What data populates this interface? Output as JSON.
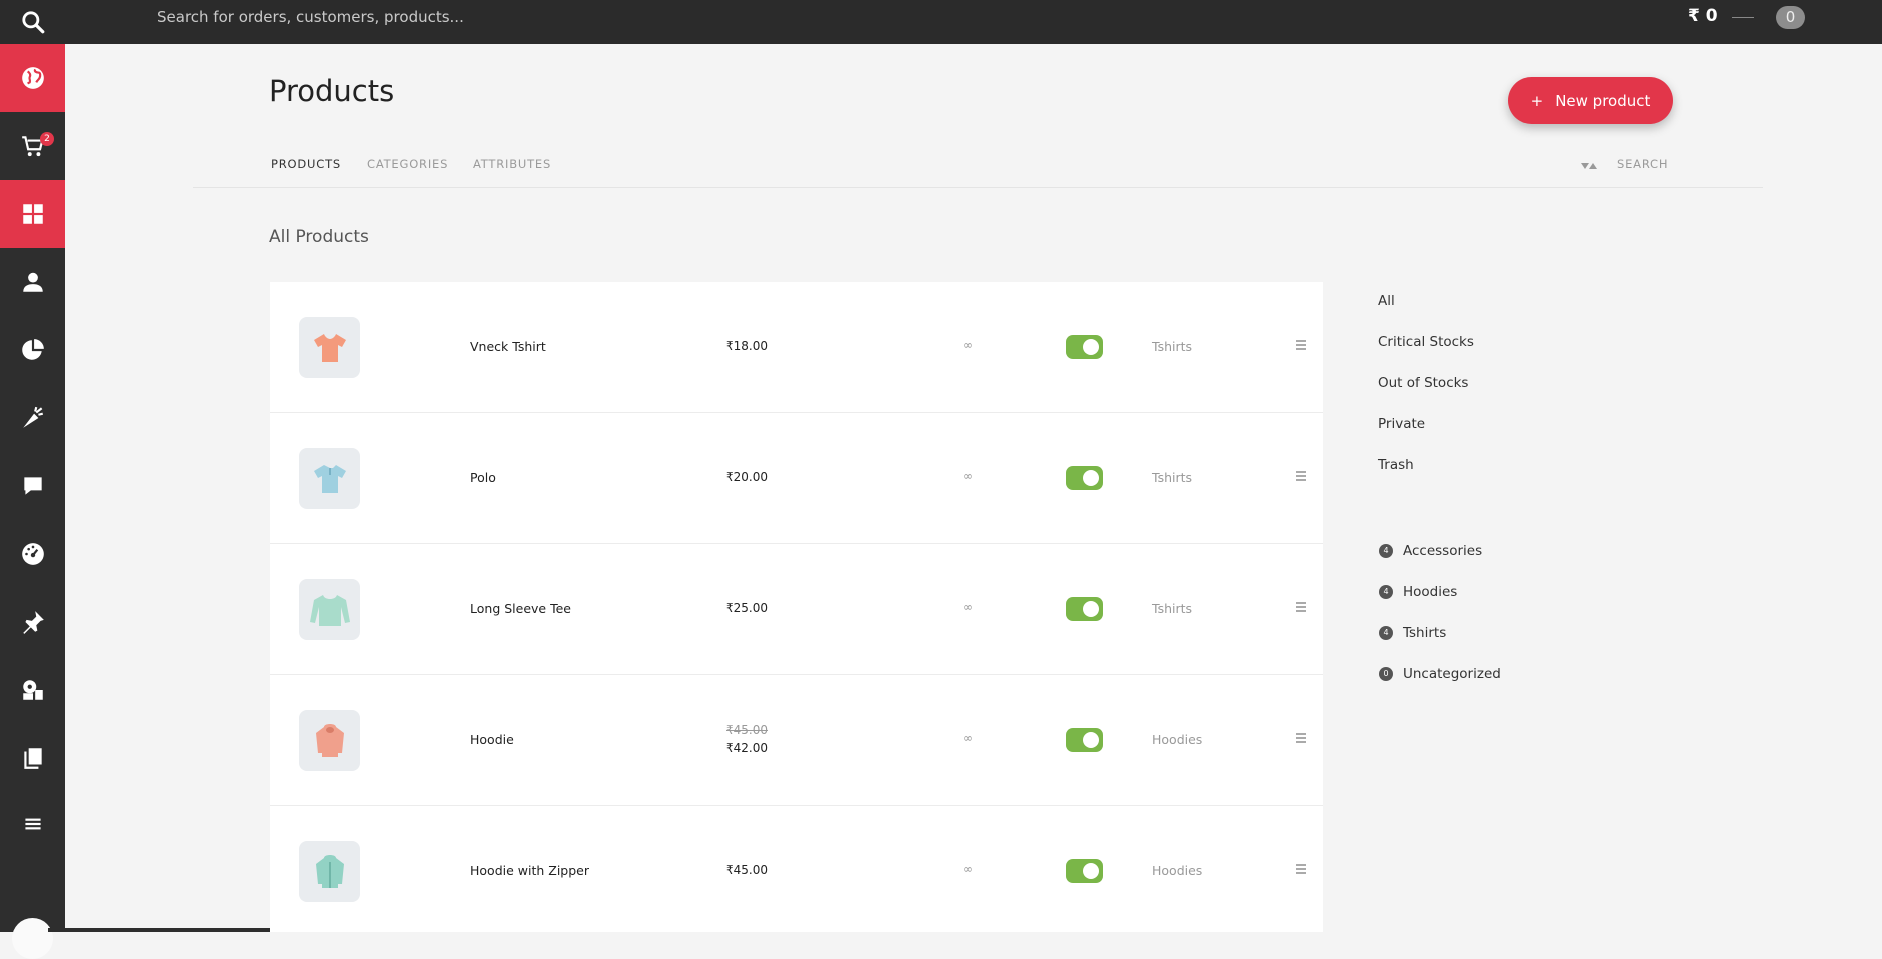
{
  "topbar": {
    "search_placeholder": "Search for orders, customers, products...",
    "balance": "₹ 0",
    "bubble_count": "0"
  },
  "sidebar": {
    "cart_badge": "2",
    "items": [
      {
        "icon": "globe-icon"
      },
      {
        "icon": "cart-icon"
      },
      {
        "icon": "dashboard-grid-icon"
      },
      {
        "icon": "user-icon"
      },
      {
        "icon": "pie-chart-icon"
      },
      {
        "icon": "carrot-icon"
      },
      {
        "icon": "comment-icon"
      },
      {
        "icon": "gauge-icon"
      },
      {
        "icon": "pin-icon"
      },
      {
        "icon": "settings-icon"
      },
      {
        "icon": "copy-icon"
      },
      {
        "icon": "menu-icon"
      }
    ]
  },
  "header": {
    "title": "Products",
    "new_button_plus": "+",
    "new_button_label": "New product",
    "tabs": [
      "PRODUCTS",
      "CATEGORIES",
      "ATTRIBUTES"
    ],
    "search_label": "SEARCH"
  },
  "section_title": "All Products",
  "products": [
    {
      "name": "Vneck Tshirt",
      "price": "₹18.00",
      "stock": "∞",
      "category": "Tshirts",
      "enabled": true,
      "color": "#f49a7c"
    },
    {
      "name": "Polo",
      "price": "₹20.00",
      "stock": "∞",
      "category": "Tshirts",
      "enabled": true,
      "color": "#9fd0e0"
    },
    {
      "name": "Long Sleeve Tee",
      "price": "₹25.00",
      "stock": "∞",
      "category": "Tshirts",
      "enabled": true,
      "color": "#a9dccb"
    },
    {
      "name": "Hoodie",
      "price_old": "₹45.00",
      "price": "₹42.00",
      "stock": "∞",
      "category": "Hoodies",
      "enabled": true,
      "color": "#f0a08c"
    },
    {
      "name": "Hoodie with Zipper",
      "price": "₹45.00",
      "stock": "∞",
      "category": "Hoodies",
      "enabled": true,
      "color": "#92d2c4"
    }
  ],
  "filters": [
    "All",
    "Critical Stocks",
    "Out of Stocks",
    "Private",
    "Trash"
  ],
  "categories": [
    {
      "name": "Accessories",
      "count": "4"
    },
    {
      "name": "Hoodies",
      "count": "4"
    },
    {
      "name": "Tshirts",
      "count": "4"
    },
    {
      "name": "Uncategorized",
      "count": "0"
    }
  ],
  "colors": {
    "accent": "#e2364a",
    "toggle_on": "#7ab648",
    "topbar": "#2b2b2b",
    "sidebar": "#2e2e2e"
  }
}
